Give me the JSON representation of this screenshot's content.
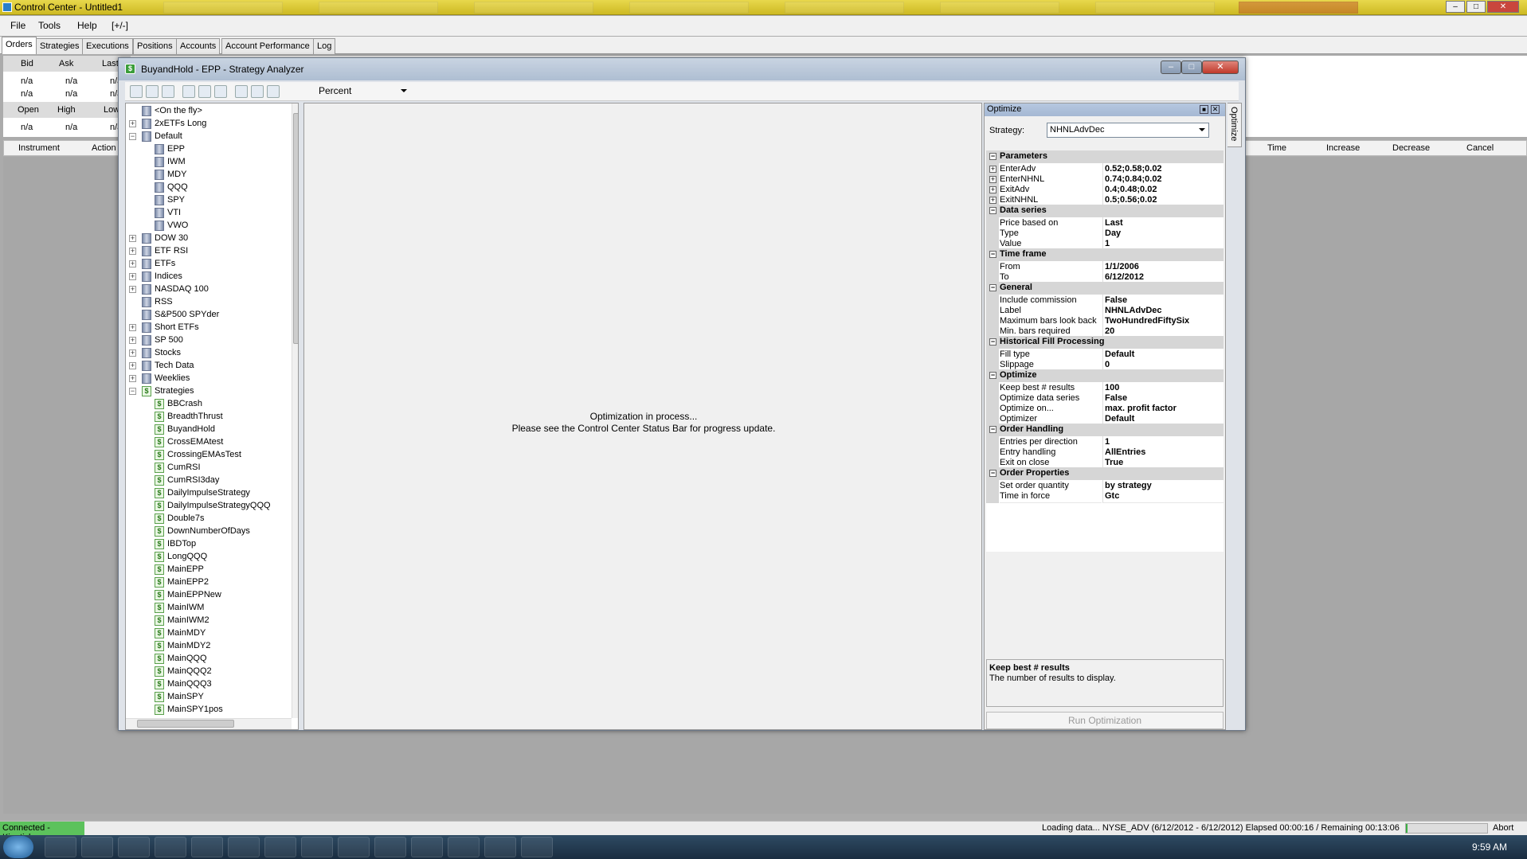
{
  "window": {
    "title": "Control Center - Untitled1",
    "menu": [
      "File",
      "Tools",
      "Help",
      "[+/-]"
    ]
  },
  "control_tabs": [
    "Orders",
    "Strategies",
    "Executions",
    "Positions",
    "Accounts",
    "Account Performance",
    "Log"
  ],
  "quote_grid": {
    "headers1": [
      "Bid",
      "Ask",
      "Last"
    ],
    "row1": [
      "n/a",
      "n/a",
      "n/a"
    ],
    "row2": [
      "n/a",
      "n/a",
      "n/a"
    ],
    "headers2": [
      "Open",
      "High",
      "Low"
    ],
    "row3": [
      "n/a",
      "n/a",
      "n/a"
    ]
  },
  "orders_columns": {
    "left": [
      "Instrument",
      "Action"
    ],
    "right": [
      "Time",
      "Increase",
      "Decrease",
      "Cancel"
    ]
  },
  "analyzer": {
    "title": "BuyandHold - EPP - Strategy Analyzer",
    "toolbar_select": "Percent",
    "tree": [
      {
        "label": "<On the fly>",
        "type": "folder",
        "level": 0,
        "expander": ""
      },
      {
        "label": "2xETFs Long",
        "type": "folder",
        "level": 0,
        "expander": "+"
      },
      {
        "label": "Default",
        "type": "folder",
        "level": 0,
        "expander": "-"
      },
      {
        "label": "EPP",
        "type": "folder",
        "level": 1,
        "expander": ""
      },
      {
        "label": "IWM",
        "type": "folder",
        "level": 1,
        "expander": ""
      },
      {
        "label": "MDY",
        "type": "folder",
        "level": 1,
        "expander": ""
      },
      {
        "label": "QQQ",
        "type": "folder",
        "level": 1,
        "expander": ""
      },
      {
        "label": "SPY",
        "type": "folder",
        "level": 1,
        "expander": ""
      },
      {
        "label": "VTI",
        "type": "folder",
        "level": 1,
        "expander": ""
      },
      {
        "label": "VWO",
        "type": "folder",
        "level": 1,
        "expander": ""
      },
      {
        "label": "DOW 30",
        "type": "folder",
        "level": 0,
        "expander": "+"
      },
      {
        "label": "ETF RSI",
        "type": "folder",
        "level": 0,
        "expander": "+"
      },
      {
        "label": "ETFs",
        "type": "folder",
        "level": 0,
        "expander": "+"
      },
      {
        "label": "Indices",
        "type": "folder",
        "level": 0,
        "expander": "+"
      },
      {
        "label": "NASDAQ 100",
        "type": "folder",
        "level": 0,
        "expander": "+"
      },
      {
        "label": "RSS",
        "type": "folder",
        "level": 0,
        "expander": ""
      },
      {
        "label": "S&P500 SPYder",
        "type": "folder",
        "level": 0,
        "expander": ""
      },
      {
        "label": "Short ETFs",
        "type": "folder",
        "level": 0,
        "expander": "+"
      },
      {
        "label": "SP 500",
        "type": "folder",
        "level": 0,
        "expander": "+"
      },
      {
        "label": "Stocks",
        "type": "folder",
        "level": 0,
        "expander": "+"
      },
      {
        "label": "Tech Data",
        "type": "folder",
        "level": 0,
        "expander": "+"
      },
      {
        "label": "Weeklies",
        "type": "folder",
        "level": 0,
        "expander": "+"
      },
      {
        "label": "Strategies",
        "type": "strategy",
        "level": 0,
        "expander": "-"
      },
      {
        "label": "BBCrash",
        "type": "strategy",
        "level": 1,
        "expander": ""
      },
      {
        "label": "BreadthThrust",
        "type": "strategy",
        "level": 1,
        "expander": ""
      },
      {
        "label": "BuyandHold",
        "type": "strategy",
        "level": 1,
        "expander": ""
      },
      {
        "label": "CrossEMAtest",
        "type": "strategy",
        "level": 1,
        "expander": ""
      },
      {
        "label": "CrossingEMAsTest",
        "type": "strategy",
        "level": 1,
        "expander": ""
      },
      {
        "label": "CumRSI",
        "type": "strategy",
        "level": 1,
        "expander": ""
      },
      {
        "label": "CumRSI3day",
        "type": "strategy",
        "level": 1,
        "expander": ""
      },
      {
        "label": "DailyImpulseStrategy",
        "type": "strategy",
        "level": 1,
        "expander": ""
      },
      {
        "label": "DailyImpulseStrategyQQQ",
        "type": "strategy",
        "level": 1,
        "expander": ""
      },
      {
        "label": "Double7s",
        "type": "strategy",
        "level": 1,
        "expander": ""
      },
      {
        "label": "DownNumberOfDays",
        "type": "strategy",
        "level": 1,
        "expander": ""
      },
      {
        "label": "IBDTop",
        "type": "strategy",
        "level": 1,
        "expander": ""
      },
      {
        "label": "LongQQQ",
        "type": "strategy",
        "level": 1,
        "expander": ""
      },
      {
        "label": "MainEPP",
        "type": "strategy",
        "level": 1,
        "expander": ""
      },
      {
        "label": "MainEPP2",
        "type": "strategy",
        "level": 1,
        "expander": ""
      },
      {
        "label": "MainEPPNew",
        "type": "strategy",
        "level": 1,
        "expander": ""
      },
      {
        "label": "MainIWM",
        "type": "strategy",
        "level": 1,
        "expander": ""
      },
      {
        "label": "MainIWM2",
        "type": "strategy",
        "level": 1,
        "expander": ""
      },
      {
        "label": "MainMDY",
        "type": "strategy",
        "level": 1,
        "expander": ""
      },
      {
        "label": "MainMDY2",
        "type": "strategy",
        "level": 1,
        "expander": ""
      },
      {
        "label": "MainQQQ",
        "type": "strategy",
        "level": 1,
        "expander": ""
      },
      {
        "label": "MainQQQ2",
        "type": "strategy",
        "level": 1,
        "expander": ""
      },
      {
        "label": "MainQQQ3",
        "type": "strategy",
        "level": 1,
        "expander": ""
      },
      {
        "label": "MainSPY",
        "type": "strategy",
        "level": 1,
        "expander": ""
      },
      {
        "label": "MainSPY1pos",
        "type": "strategy",
        "level": 1,
        "expander": ""
      }
    ],
    "center_message_line1": "Optimization in process...",
    "center_message_line2": "Please see the Control Center Status Bar for progress update.",
    "optimize": {
      "panel_title": "Optimize",
      "side_tab": "Optimize",
      "strategy_label": "Strategy:",
      "strategy_value": "NHNLAdvDec",
      "groups": [
        {
          "name": "Parameters",
          "rows": [
            {
              "name": "EnterAdv",
              "value": "0.52;0.58;0.02",
              "expander": "+"
            },
            {
              "name": "EnterNHNL",
              "value": "0.74;0.84;0.02",
              "expander": "+"
            },
            {
              "name": "ExitAdv",
              "value": "0.4;0.48;0.02",
              "expander": "+"
            },
            {
              "name": "ExitNHNL",
              "value": "0.5;0.56;0.02",
              "expander": "+"
            }
          ]
        },
        {
          "name": "Data series",
          "rows": [
            {
              "name": "Price based on",
              "value": "Last",
              "expander": ""
            },
            {
              "name": "Type",
              "value": "Day",
              "expander": ""
            },
            {
              "name": "Value",
              "value": "1",
              "expander": ""
            }
          ]
        },
        {
          "name": "Time frame",
          "rows": [
            {
              "name": "From",
              "value": "1/1/2006",
              "expander": ""
            },
            {
              "name": "To",
              "value": "6/12/2012",
              "expander": ""
            }
          ]
        },
        {
          "name": "General",
          "rows": [
            {
              "name": "Include commission",
              "value": "False",
              "expander": ""
            },
            {
              "name": "Label",
              "value": "NHNLAdvDec",
              "expander": ""
            },
            {
              "name": "Maximum bars look back",
              "value": "TwoHundredFiftySix",
              "expander": ""
            },
            {
              "name": "Min. bars required",
              "value": "20",
              "expander": ""
            }
          ]
        },
        {
          "name": "Historical Fill Processing",
          "rows": [
            {
              "name": "Fill type",
              "value": "Default",
              "expander": ""
            },
            {
              "name": "Slippage",
              "value": "0",
              "expander": ""
            }
          ]
        },
        {
          "name": "Optimize",
          "rows": [
            {
              "name": "Keep best # results",
              "value": "100",
              "expander": ""
            },
            {
              "name": "Optimize data series",
              "value": "False",
              "expander": ""
            },
            {
              "name": "Optimize on...",
              "value": "max. profit factor",
              "expander": ""
            },
            {
              "name": "Optimizer",
              "value": "Default",
              "expander": ""
            }
          ]
        },
        {
          "name": "Order Handling",
          "rows": [
            {
              "name": "Entries per direction",
              "value": "1",
              "expander": ""
            },
            {
              "name": "Entry handling",
              "value": "AllEntries",
              "expander": ""
            },
            {
              "name": "Exit on close",
              "value": "True",
              "expander": ""
            }
          ]
        },
        {
          "name": "Order Properties",
          "rows": [
            {
              "name": "Set order quantity",
              "value": "by strategy",
              "expander": ""
            },
            {
              "name": "Time in force",
              "value": "Gtc",
              "expander": ""
            }
          ]
        }
      ],
      "desc_title": "Keep best # results",
      "desc_text": "The number of results to display.",
      "run_button": "Run Optimization"
    }
  },
  "status": {
    "connection": "Connected - Kinetick",
    "loading": "Loading data... NYSE_ADV  (6/12/2012 - 6/12/2012)  Elapsed 00:00:16 / Remaining 00:13:06",
    "abort": "Abort"
  },
  "taskbar": {
    "clock": "9:59 AM"
  },
  "colors": {
    "title_bar": "#d9c638",
    "status_connected": "#4caf50",
    "taskbar": "#1f3448"
  }
}
